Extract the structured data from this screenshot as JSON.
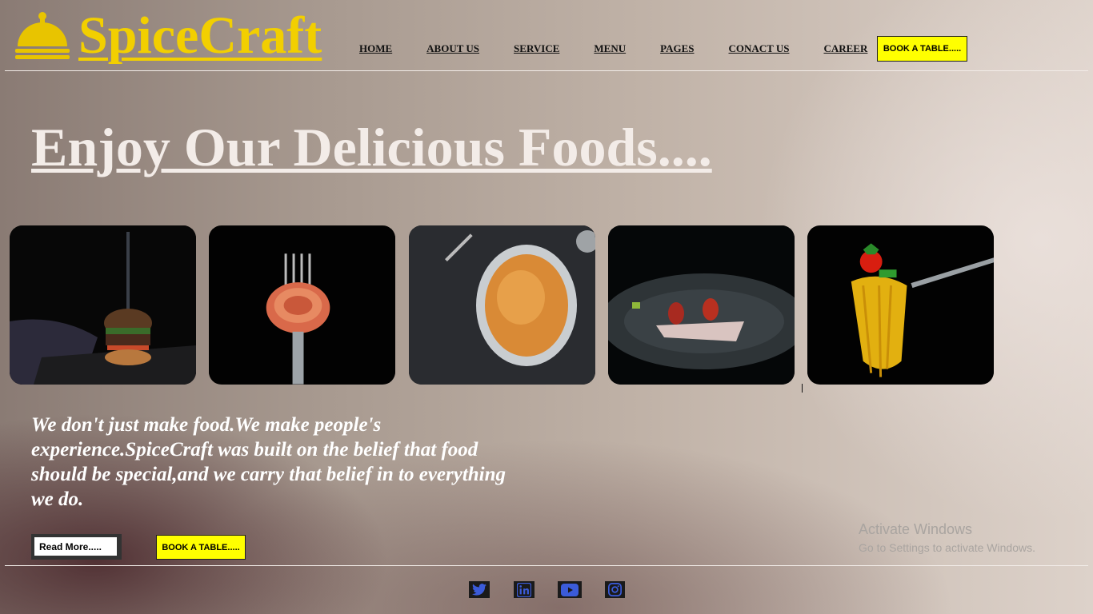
{
  "brand": {
    "name": "SpiceCraft",
    "icon": "food-cloche-icon",
    "color": "#f2cf00"
  },
  "nav": {
    "items": [
      "HOME",
      "ABOUT US",
      "SERVICE",
      "MENU",
      "PAGES",
      "CONACT US",
      "CAREER"
    ],
    "book_label": "BOOK A TABLE....."
  },
  "hero": {
    "title": "Enjoy Our Delicious Foods....",
    "tagline": "We don't just make food.We make people's experience.SpiceCraft was built on the belief that food should be special,and we carry that belief in to everything we do.",
    "read_more_label": "Read More.....",
    "book_label": "BOOK A TABLE....."
  },
  "gallery": [
    {
      "name": "burger-image"
    },
    {
      "name": "spaghetti-fork-image"
    },
    {
      "name": "penne-plate-image"
    },
    {
      "name": "shrimp-plate-image"
    },
    {
      "name": "spaghetti-tomato-fork-image"
    }
  ],
  "watermark": {
    "line1": "Activate Windows",
    "line2": "Go to Settings to activate Windows."
  },
  "social": [
    "twitter-icon",
    "linkedin-icon",
    "youtube-icon",
    "instagram-icon"
  ],
  "colors": {
    "accent": "#ffff00",
    "icon_blue": "#3b5bd9",
    "title": "#f3ece8"
  }
}
